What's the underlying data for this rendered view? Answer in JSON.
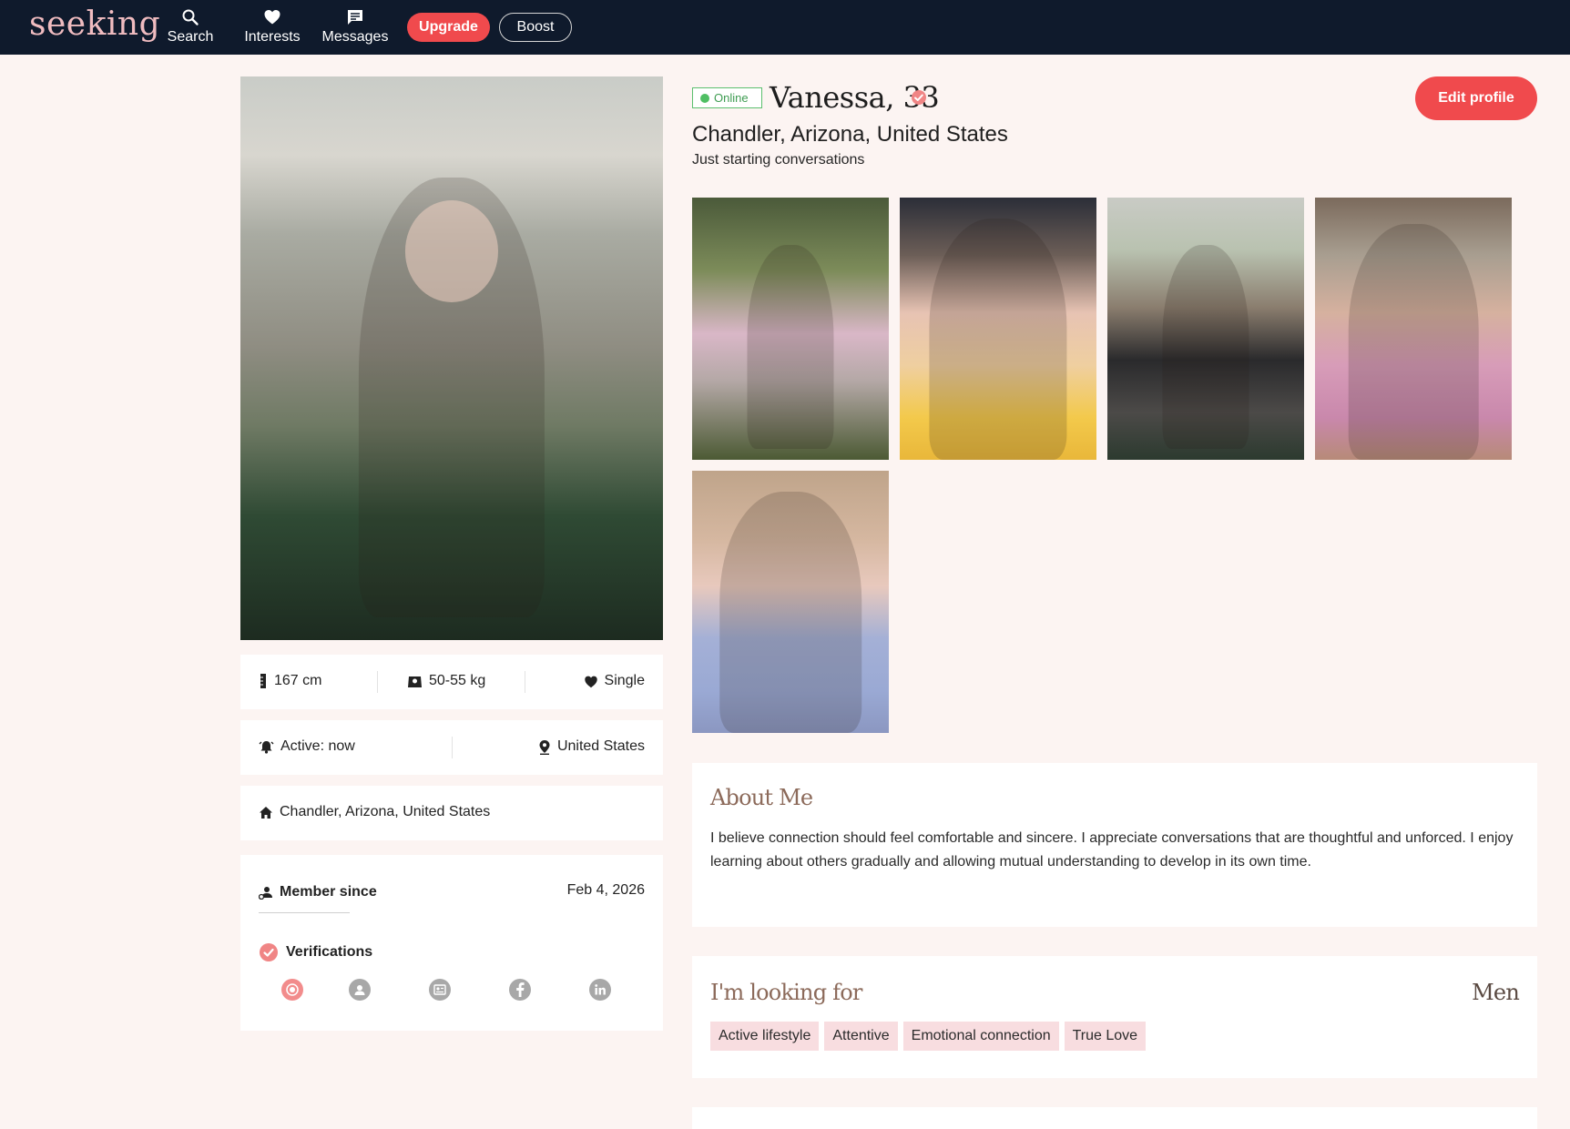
{
  "nav": {
    "logo": "seeking",
    "items": [
      {
        "label": "Search",
        "icon": "search-icon"
      },
      {
        "label": "Interests",
        "icon": "heart-icon"
      },
      {
        "label": "Messages",
        "icon": "message-icon"
      }
    ],
    "upgrade_label": "Upgrade",
    "boost_label": "Boost"
  },
  "profile": {
    "online_label": "Online",
    "name": "Vanessa, 33",
    "location": "Chandler, Arizona, United States",
    "tagline": "Just starting conversations",
    "edit_label": "Edit profile"
  },
  "stats": {
    "height": "167 cm",
    "weight": "50-55 kg",
    "status": "Single",
    "active": "Active: now",
    "country": "United States",
    "home": "Chandler, Arizona, United States"
  },
  "member": {
    "since_label": "Member since",
    "since_date": "Feb 4, 2026",
    "verifications_label": "Verifications",
    "verification_icons": [
      "photo-verified-icon",
      "profile-icon",
      "id-card-icon",
      "facebook-icon",
      "linkedin-icon"
    ]
  },
  "about": {
    "title": "About Me",
    "text": "I believe connection should feel comfortable and sincere. I appreciate conversations that are thoughtful and unforced. I enjoy learning about others gradually and allowing mutual understanding to develop in its own time."
  },
  "looking_for": {
    "title": "I'm looking for",
    "gender": "Men",
    "tags": [
      "Active lifestyle",
      "Attentive",
      "Emotional connection",
      "True Love"
    ]
  },
  "colors": {
    "nav_bg": "#0f1a2c",
    "accent": "#f04a4d",
    "page_bg": "#fcf4f2",
    "online": "#4fbf63",
    "tag_bg": "#f8dde0"
  }
}
